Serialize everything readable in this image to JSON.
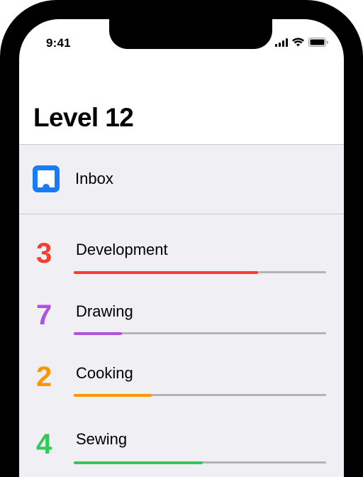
{
  "status_bar": {
    "time": "9:41",
    "icons": [
      "cellular-signal-icon",
      "wifi-icon",
      "battery-icon"
    ]
  },
  "page": {
    "title": "Level 12"
  },
  "inbox": {
    "label": "Inbox",
    "icon": "inbox-icon",
    "icon_color": "#1a7cf4"
  },
  "skills": [
    {
      "number": "3",
      "name": "Development",
      "color": "#ff3b30",
      "progress": 0.73
    },
    {
      "number": "7",
      "name": "Drawing",
      "color": "#af52de",
      "progress": 0.19
    },
    {
      "number": "2",
      "name": "Cooking",
      "color": "#ff9500",
      "progress": 0.31
    },
    {
      "number": "4",
      "name": "Sewing",
      "color": "#34c759",
      "progress": 0.51
    }
  ]
}
